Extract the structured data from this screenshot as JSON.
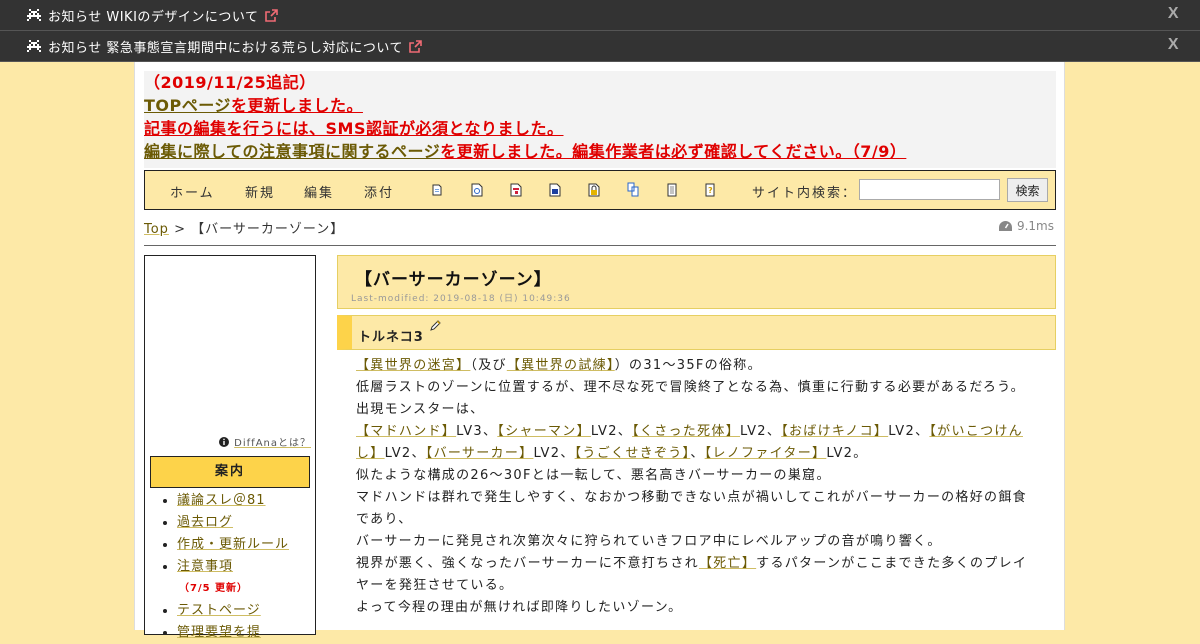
{
  "notices": [
    {
      "text": "お知らせ WIKIのデザインについて",
      "close": "X"
    },
    {
      "text": "お知らせ 緊急事態宣言期間中における荒らし対応について",
      "close": "X"
    }
  ],
  "announce": {
    "line1": "（2019/11/25追記）",
    "line2_link": "TOPページ",
    "line2_rest": "を更新しました。",
    "line3": "記事の編集を行うには、SMS認証が必須となりました。",
    "line4_link": "編集に際しての注意事項に関するページ",
    "line4_rest": "を更新しました。編集作業者は必ず確認してください。（7/9）"
  },
  "toolbar": {
    "home": "ホーム",
    "new": "新規",
    "edit": "編集",
    "attach": "添付",
    "search_label": "サイト内検索：",
    "search_value": "",
    "search_button": "検索"
  },
  "breadcrumb": {
    "top": "Top",
    "sep": ">",
    "current": "【バーサーカーゾーン】"
  },
  "timing": "9.1ms",
  "menubar": {
    "diffana": "DiffAnaとは？",
    "heading": "案内",
    "items": [
      "議論スレ＠81",
      "過去ログ",
      "作成・更新ルール",
      "注意事項",
      "テストページ",
      "管理要望を提"
    ],
    "notice_update": "（7/5 更新）"
  },
  "page": {
    "title": "【バーサーカーゾーン】",
    "last_modified": "Last-modified: 2019-08-18 (日) 10:49:36",
    "section": "トルネコ3"
  },
  "content": {
    "l1_a": "【異世界の迷宮】",
    "l1_b": "（及び",
    "l1_c": "【異世界の試練】",
    "l1_d": "）の31～35Fの俗称。",
    "l2": "低層ラストのゾーンに位置するが、理不尽な死で冒険終了となる為、慎重に行動する必要があるだろう。",
    "l3": "出現モンスターは、",
    "monsters": [
      {
        "name": "【マドハンド】",
        "lv": "LV3、"
      },
      {
        "name": "【シャーマン】",
        "lv": "LV2、"
      },
      {
        "name": "【くさった死体】",
        "lv": "LV2、"
      },
      {
        "name": "【おばけキノコ】",
        "lv": "LV2、"
      },
      {
        "name": "【がいこつけんし】",
        "lv": "LV2、"
      },
      {
        "name": "【バーサーカー】",
        "lv": "LV2、"
      },
      {
        "name": "【うごくせきぞう】",
        "lv": "、"
      },
      {
        "name": "【レノファイター】",
        "lv": "LV2。"
      }
    ],
    "l5": "似たような構成の26～30Fとは一転して、悪名高きバーサーカーの巣窟。",
    "l6": "マドハンドは群れで発生しやすく、なおかつ移動できない点が禍いしてこれがバーサーカーの格好の餌食であり、",
    "l7": "バーサーカーに発見され次第次々に狩られていきフロア中にレベルアップの音が鳴り響く。",
    "l8_a": "視界が悪く、強くなったバーサーカーに不意打ちされ",
    "l8_link": "【死亡】",
    "l8_b": "するパターンがここまできた多くのプレイヤーを発狂させている。",
    "l9": "よって今程の理由が無ければ即降りしたいゾーン。"
  }
}
